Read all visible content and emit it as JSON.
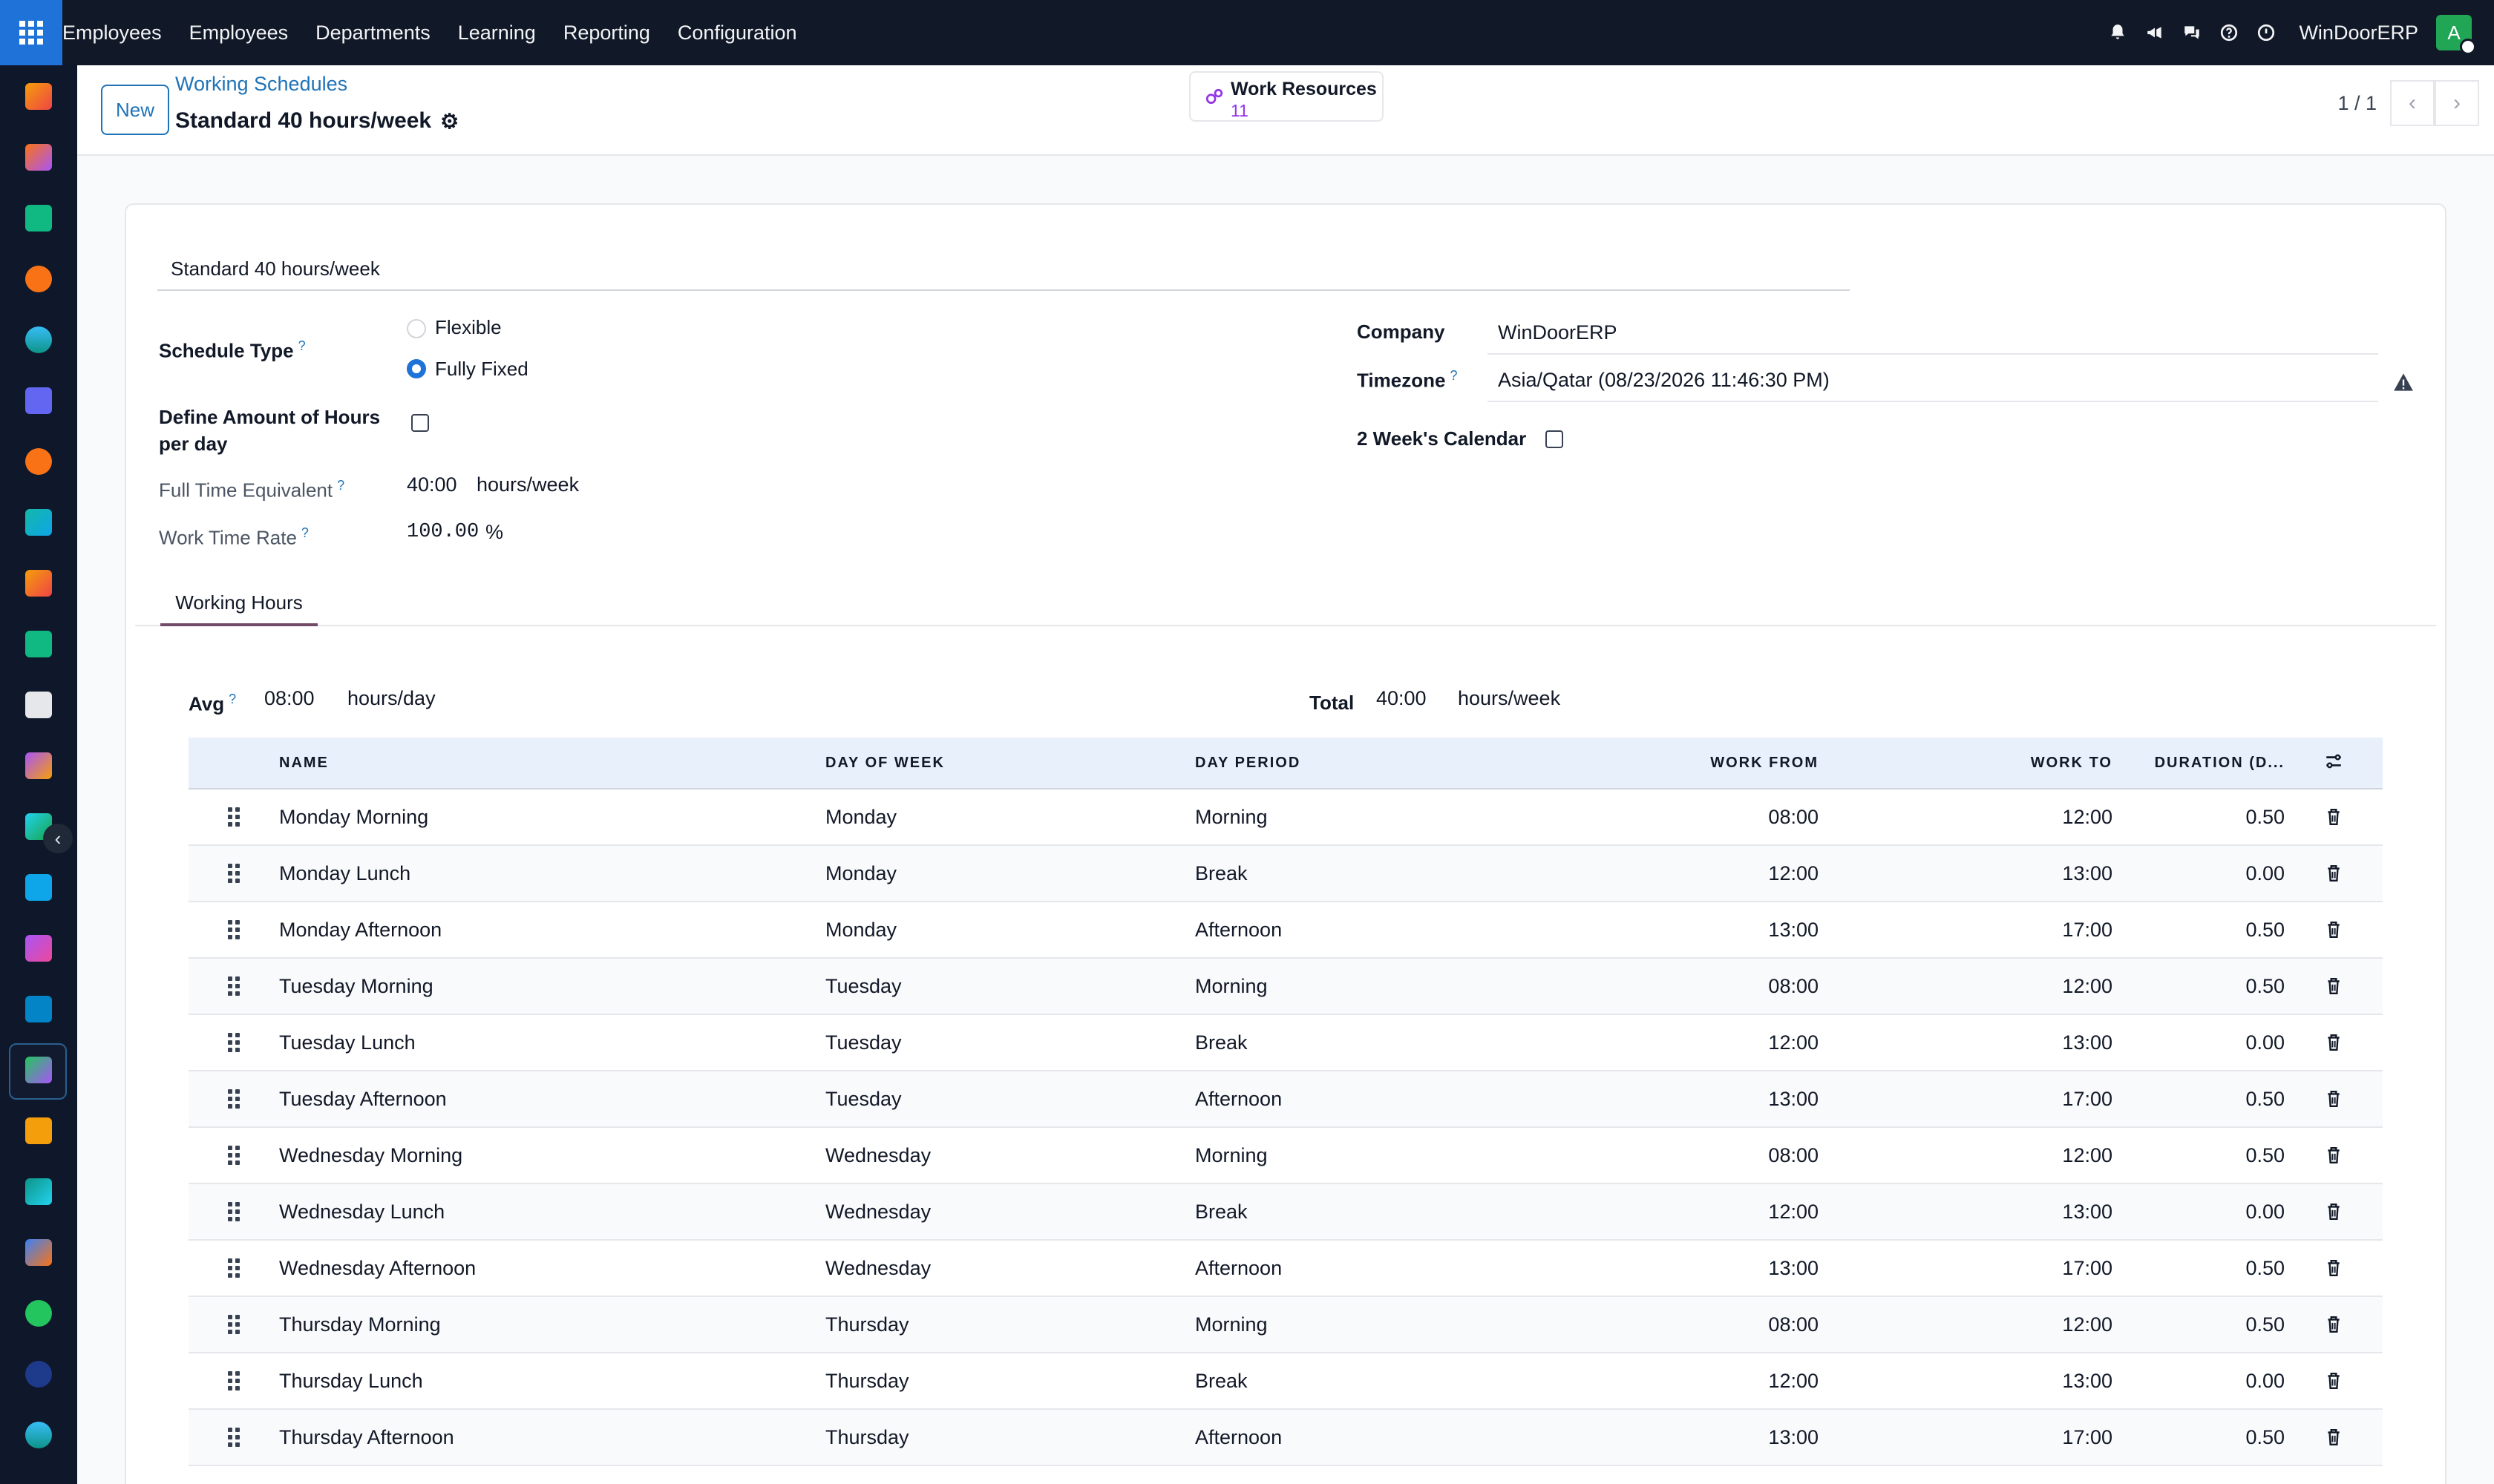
{
  "navbar": {
    "brand": "Employees",
    "menu": [
      "Employees",
      "Departments",
      "Learning",
      "Reporting",
      "Configuration"
    ],
    "company": "WinDoorERP",
    "avatar_letter": "A",
    "icons": [
      "bell-icon",
      "megaphone-icon",
      "chat-icon",
      "help-icon",
      "clock-icon"
    ]
  },
  "control": {
    "new_label": "New",
    "breadcrumb": "Working Schedules",
    "record_title": "Standard 40 hours/week",
    "smart_button": {
      "label": "Work Resources",
      "count": "11"
    },
    "pager": "1 / 1"
  },
  "form": {
    "name": "Standard 40 hours/week",
    "schedule_type_label": "Schedule Type",
    "schedule_options": [
      "Flexible",
      "Fully Fixed"
    ],
    "schedule_selected": "Fully Fixed",
    "define_hours_label": "Define Amount of Hours per day",
    "define_hours_checked": false,
    "fte_label": "Full Time Equivalent",
    "fte_value": "40:00",
    "fte_unit": "hours/week",
    "rate_label": "Work Time Rate",
    "rate_value": "100.00",
    "rate_unit": "%",
    "company_label": "Company",
    "company_value": "WinDoorERP",
    "timezone_label": "Timezone",
    "timezone_value": "Asia/Qatar (08/23/2026 11:46:30 PM)",
    "two_week_label": "2 Week's Calendar",
    "two_week_checked": false,
    "help_mark": "?"
  },
  "tabs": {
    "working_hours": "Working Hours"
  },
  "summary": {
    "avg_label": "Avg",
    "avg_value": "08:00",
    "avg_unit": "hours/day",
    "total_label": "Total",
    "total_value": "40:00",
    "total_unit": "hours/week"
  },
  "table": {
    "headers": [
      "NAME",
      "DAY OF WEEK",
      "DAY PERIOD",
      "WORK FROM",
      "WORK TO",
      "DURATION (D..."
    ],
    "rows": [
      [
        "Monday Morning",
        "Monday",
        "Morning",
        "08:00",
        "12:00",
        "0.50"
      ],
      [
        "Monday Lunch",
        "Monday",
        "Break",
        "12:00",
        "13:00",
        "0.00"
      ],
      [
        "Monday Afternoon",
        "Monday",
        "Afternoon",
        "13:00",
        "17:00",
        "0.50"
      ],
      [
        "Tuesday Morning",
        "Tuesday",
        "Morning",
        "08:00",
        "12:00",
        "0.50"
      ],
      [
        "Tuesday Lunch",
        "Tuesday",
        "Break",
        "12:00",
        "13:00",
        "0.00"
      ],
      [
        "Tuesday Afternoon",
        "Tuesday",
        "Afternoon",
        "13:00",
        "17:00",
        "0.50"
      ],
      [
        "Wednesday Morning",
        "Wednesday",
        "Morning",
        "08:00",
        "12:00",
        "0.50"
      ],
      [
        "Wednesday Lunch",
        "Wednesday",
        "Break",
        "12:00",
        "13:00",
        "0.00"
      ],
      [
        "Wednesday Afternoon",
        "Wednesday",
        "Afternoon",
        "13:00",
        "17:00",
        "0.50"
      ],
      [
        "Thursday Morning",
        "Thursday",
        "Morning",
        "08:00",
        "12:00",
        "0.50"
      ],
      [
        "Thursday Lunch",
        "Thursday",
        "Break",
        "12:00",
        "13:00",
        "0.00"
      ],
      [
        "Thursday Afternoon",
        "Thursday",
        "Afternoon",
        "13:00",
        "17:00",
        "0.50"
      ]
    ]
  },
  "colors": {
    "navbar_bg": "#111827",
    "accent": "#1f73d8",
    "link": "#1f73b7",
    "tab_underline": "#714b67",
    "table_header_bg": "#e8f0fb"
  }
}
